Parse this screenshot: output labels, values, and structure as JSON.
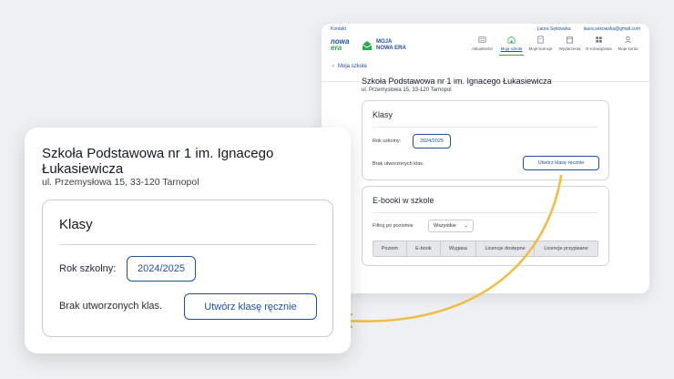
{
  "window": {
    "top_left_link": "Kontakt",
    "top_right_links": [
      "Laura Sękowska",
      "laura.sekowska@gmail.com"
    ],
    "logo_nowa_era": [
      "nowa",
      "era"
    ],
    "logo_moja_nowa_era": [
      "MOJA",
      "NOWA ERA"
    ],
    "nav": [
      {
        "label": "Aktualności",
        "icon": "news-icon",
        "active": false
      },
      {
        "label": "Moja szkoła",
        "icon": "school-icon",
        "active": true
      },
      {
        "label": "Moje licencje",
        "icon": "licence-icon",
        "active": false
      },
      {
        "label": "Wydarzenia",
        "icon": "calendar-icon",
        "active": false
      },
      {
        "label": "E-rozwiązania",
        "icon": "grid-icon",
        "active": false
      },
      {
        "label": "Moje konto",
        "icon": "user-icon",
        "active": false
      }
    ],
    "back_link": "Moja szkoła",
    "school_name": "Szkoła Podstawowa nr 1 im. Ignacego Łukasiewicza",
    "school_address": "ul. Przemysłowa 15, 33-120 Tarnopol",
    "classes": {
      "title": "Klasy",
      "year_label": "Rok szkolny:",
      "year_value": "2024/2025",
      "empty_text": "Brak utworzonych klas.",
      "create_button": "Utwórz klasę ręcznie"
    },
    "ebooks": {
      "title": "E-booki w szkole",
      "filter_label": "Filtruj po poziomie",
      "filter_value": "Wszystkie",
      "columns": [
        "Poziom",
        "E-book",
        "Wygasa",
        "Licencje dostępne",
        "Licencje przypisane"
      ]
    }
  },
  "zoom": {
    "school_name": "Szkoła Podstawowa nr 1 im. Ignacego Łukasiewicza",
    "school_address": "ul. Przemysłowa 15, 33-120 Tarnopol",
    "classes_title": "Klasy",
    "year_label": "Rok szkolny:",
    "year_value": "2024/2025",
    "empty_text": "Brak utworzonych klas.",
    "create_button": "Utwórz klasę ręcznie"
  },
  "colors": {
    "primary_blue": "#1e4fa8",
    "brand_green": "#2ea84c",
    "arrow_yellow": "#f2bd3f"
  }
}
